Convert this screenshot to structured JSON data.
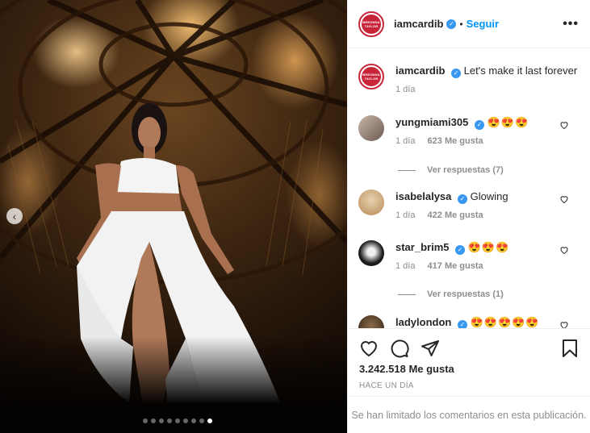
{
  "post": {
    "username": "iamcardib",
    "follow_label": "Seguir",
    "separator": "•",
    "more_label": "•••",
    "avatar_text": "BREONNA TAYLOR",
    "caption": "Let's make it last forever",
    "caption_time": "1 día",
    "likes": "3.242.518 Me gusta",
    "posted": "HACE UN DÍA",
    "limited_notice": "Se han limitado los comentarios en esta publicación.",
    "carousel": {
      "count": 9,
      "active_index": 8
    }
  },
  "comments": [
    {
      "user": "yungmiami305",
      "text": "😍😍😍",
      "time": "1 día",
      "likes": "623 Me gusta",
      "replies": "Ver respuestas (7)"
    },
    {
      "user": "isabelalysa",
      "text": "Glowing",
      "time": "1 día",
      "likes": "422 Me gusta"
    },
    {
      "user": "star_brim5",
      "text": "😍😍😍",
      "time": "1 día",
      "likes": "417 Me gusta",
      "replies": "Ver respuestas (1)"
    },
    {
      "user": "ladylondon",
      "text": "😍😍😍😍😍"
    }
  ],
  "colors": {
    "accent": "#0095f6",
    "verified": "#3897f0",
    "avatar_ring": "#c8253a",
    "muted": "#8e8e8e"
  },
  "icons": [
    "chevron-left-icon",
    "more-icon",
    "verified-icon",
    "heart-icon",
    "comment-icon",
    "share-icon",
    "bookmark-icon"
  ]
}
